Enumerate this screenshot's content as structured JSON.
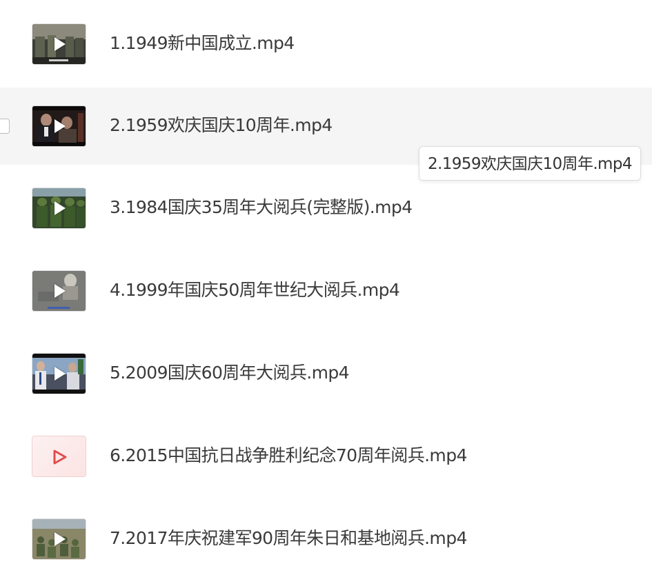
{
  "files": [
    {
      "name": "1.1949新中国成立.mp4",
      "thumb": "parade-black-white-thumbnail"
    },
    {
      "name": "2.1959欢庆国庆10周年.mp4",
      "thumb": "leaders-portrait-thumbnail"
    },
    {
      "name": "3.1984国庆35周年大阅兵(完整版).mp4",
      "thumb": "soldiers-green-thumbnail"
    },
    {
      "name": "4.1999年国庆50周年世纪大阅兵.mp4",
      "thumb": "grey-statue-thumbnail"
    },
    {
      "name": "5.2009国庆60周年大阅兵.mp4",
      "thumb": "crowd-flags-thumbnail"
    },
    {
      "name": "6.2015中国抗日战争胜利纪念70周年阅兵.mp4",
      "thumb": "video-file-icon"
    },
    {
      "name": "7.2017年庆祝建军90周年朱日和基地阅兵.mp4",
      "thumb": "troops-field-thumbnail"
    }
  ],
  "tooltip": {
    "text": "2.1959欢庆国庆10周年.mp4"
  },
  "colors": {
    "hover_row": "#f5f5f5",
    "text": "#3a3a3a",
    "video_icon_accent": "#e34b4b"
  }
}
